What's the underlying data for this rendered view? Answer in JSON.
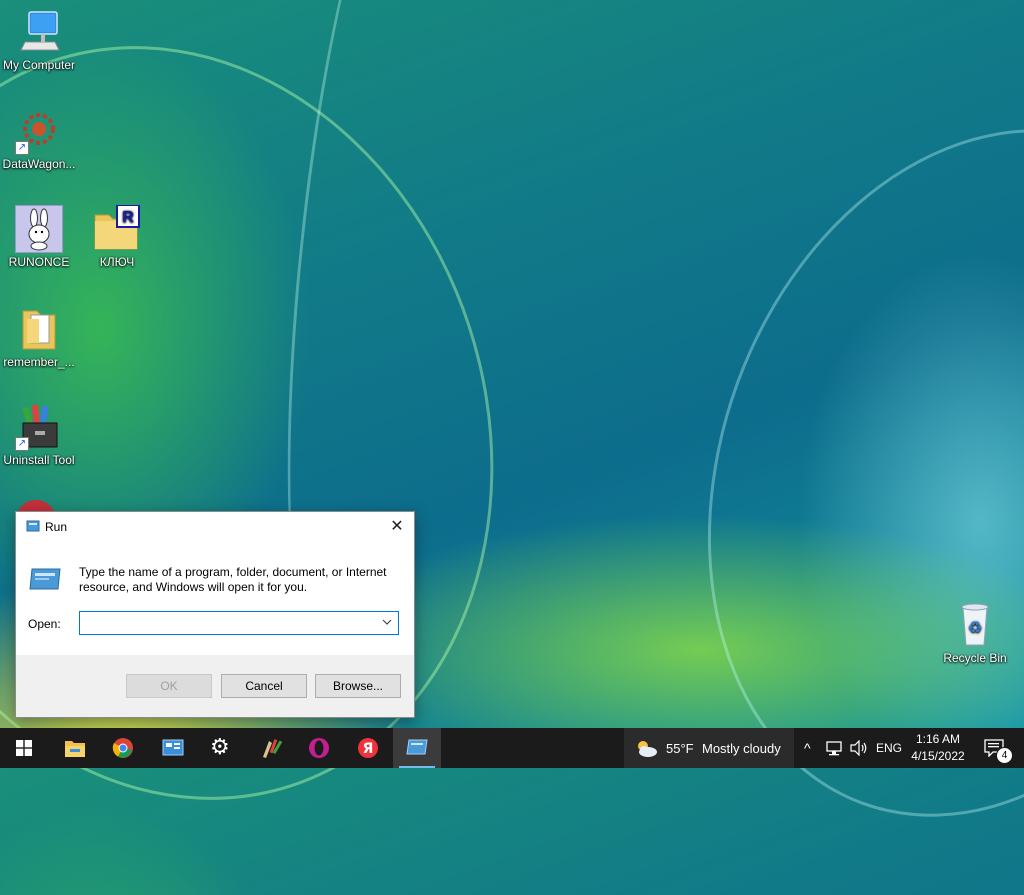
{
  "desktop": {
    "icons": [
      {
        "label": "My Computer",
        "icon": "computer-icon"
      },
      {
        "label": "DataWagon...",
        "icon": "datawagon-icon"
      },
      {
        "label": "RUNONCE",
        "icon": "rabbit-icon"
      },
      {
        "label": "КЛЮЧ",
        "icon": "folder-r-icon"
      },
      {
        "label": "remember_...",
        "icon": "folder-doc-icon"
      },
      {
        "label": "Uninstall Tool",
        "icon": "uninstall-tool-icon"
      },
      {
        "label": "Recycle Bin",
        "icon": "recycle-bin-icon"
      }
    ]
  },
  "run_dialog": {
    "title": "Run",
    "close_glyph": "✕",
    "description": "Type the name of a program, folder, document, or Internet resource, and Windows will open it for you.",
    "open_label": "Open:",
    "open_value": "",
    "ok_label": "OK",
    "cancel_label": "Cancel",
    "browse_label": "Browse..."
  },
  "taskbar": {
    "pinned": [
      "start-icon",
      "file-explorer-icon",
      "chrome-icon",
      "control-panel-icon",
      "settings-icon",
      "paint-icon",
      "opera-icon",
      "yandex-icon",
      "run-icon"
    ],
    "weather": {
      "temp": "55°F",
      "condition": "Mostly cloudy"
    },
    "tray": {
      "chevron": "^",
      "language": "ENG"
    },
    "clock": {
      "time": "1:16 AM",
      "date": "4/15/2022"
    },
    "notifications": {
      "count": "4"
    }
  },
  "colors": {
    "accent": "#0078d7",
    "taskbar": "#1b1b1b",
    "active_underline": "#76b9ed"
  }
}
